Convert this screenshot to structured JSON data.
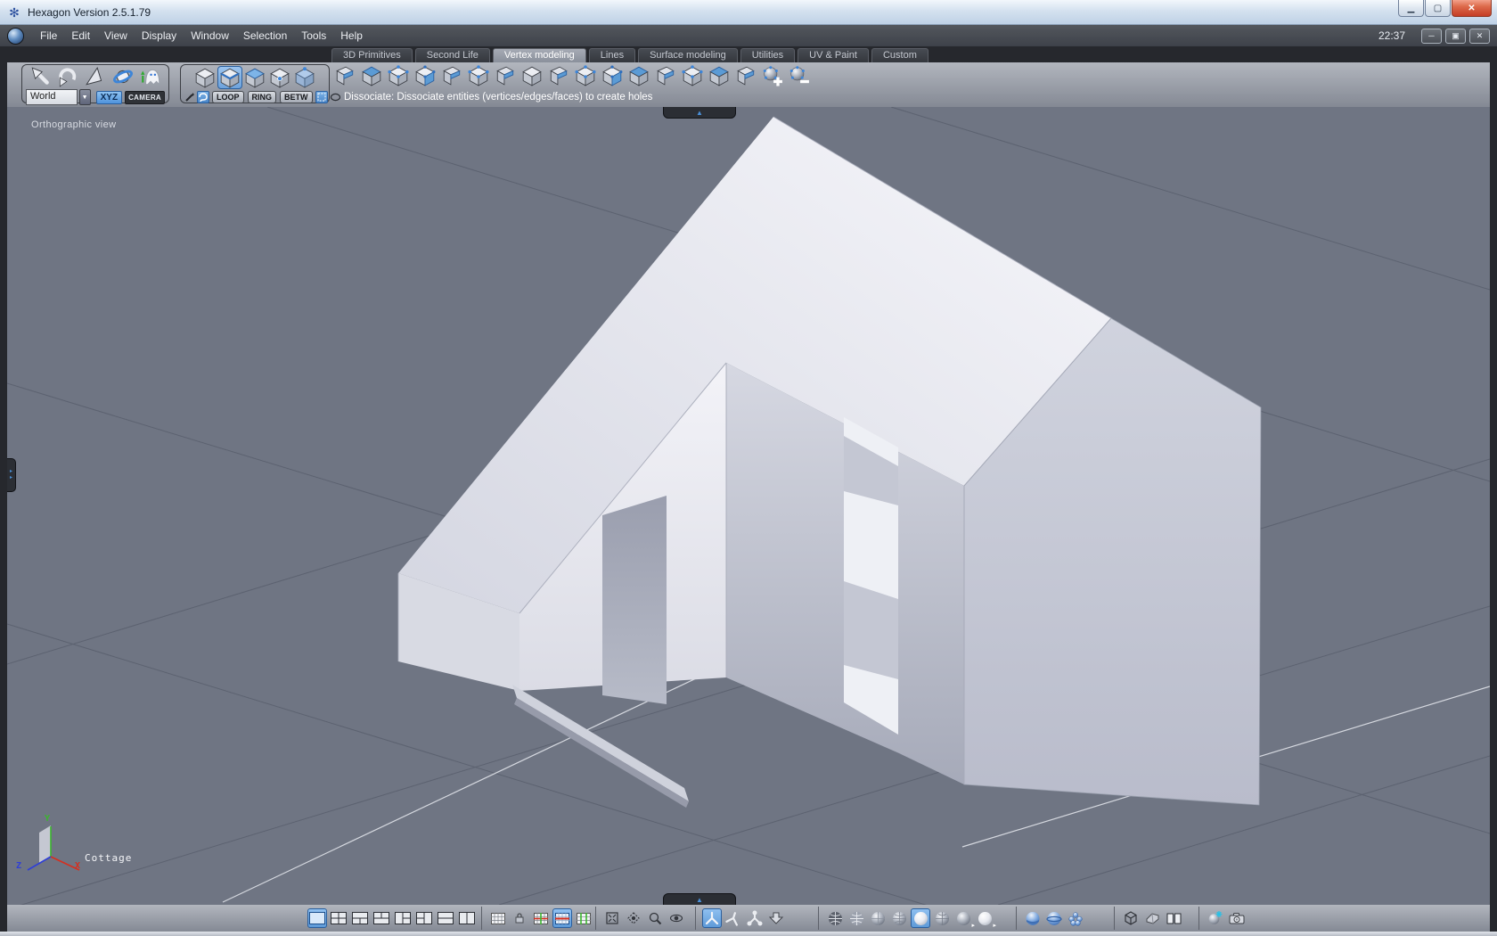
{
  "window": {
    "title": "Hexagon Version 2.5.1.79",
    "time": "22:37"
  },
  "menu": {
    "items": [
      "File",
      "Edit",
      "View",
      "Display",
      "Window",
      "Selection",
      "Tools",
      "Help"
    ]
  },
  "tabs": {
    "items": [
      "3D Primitives",
      "Second Life",
      "Vertex modeling",
      "Lines",
      "Surface modeling",
      "Utilities",
      "UV & Paint",
      "Custom"
    ],
    "active": "Vertex modeling"
  },
  "toolbar": {
    "world_selector_value": "World",
    "xyz_button_label": "XYZ",
    "camera_button_label": "CAMERA",
    "selection_buttons": [
      "LOOP",
      "RING",
      "BETW"
    ],
    "status_text": "Dissociate: Dissociate entities (vertices/edges/faces) to create holes"
  },
  "viewport": {
    "view_label": "Orthographic view",
    "object_label": "Cottage",
    "axis_labels": {
      "x": "X",
      "y": "Y",
      "z": "Z"
    }
  },
  "colors": {
    "accent_blue": "#4a90d9",
    "viewport_background": "#6f7583",
    "axis_x_red": "#d62f1f",
    "axis_y_green": "#3bb52e",
    "axis_z_blue": "#2f3fd6",
    "close_button_red": "#c43d24"
  }
}
